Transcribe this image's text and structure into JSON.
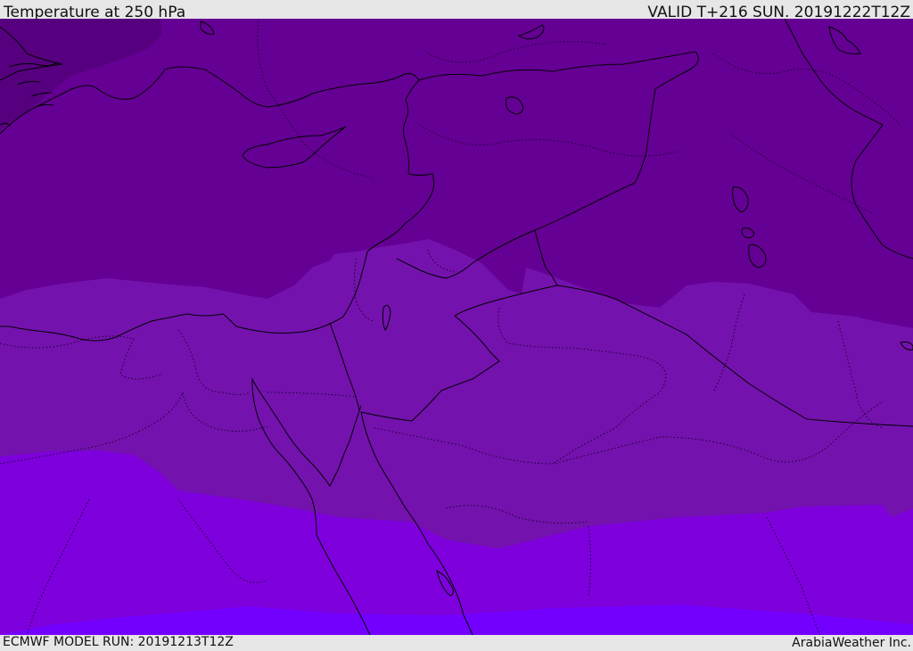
{
  "header": {
    "title": "Temperature at 250 hPa",
    "valid_time": "VALID T+216 SUN. 20191222T12Z"
  },
  "footer": {
    "model_run": "ECMWF MODEL RUN: 20191213T12Z",
    "credit": "ArabiaWeather Inc."
  },
  "map": {
    "variable": "Temperature",
    "level": "250 hPa",
    "region": "Eastern Mediterranean / Middle East",
    "colors": {
      "band_coldest": "#56007f",
      "band_cold": "#650094",
      "band_mid": "#7412ae",
      "band_warm": "#7e00dc",
      "band_warmest": "#7300ff",
      "outline": "#000000"
    }
  }
}
